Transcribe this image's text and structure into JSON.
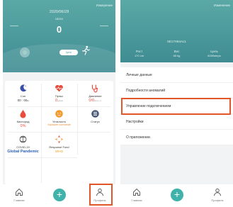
{
  "left": {
    "header": {
      "top_link": "Измерение",
      "date": "2020/06/28",
      "steps_label": "Шаги",
      "steps_value": "0",
      "goal_button": "Цель"
    },
    "tiles": [
      {
        "label": "Сон",
        "value": "00 : 00",
        "value_unit": "м",
        "icon": "moon-icon",
        "value_style": "plain"
      },
      {
        "label": "Пульс",
        "value": "0",
        "value_unit": "уд/мин",
        "icon": "heart-pulse-icon",
        "value_style": "red"
      },
      {
        "label": "Давление",
        "value": "0/0",
        "value_unit": "мм рт. ст.",
        "icon": "stethoscope-icon",
        "value_style": "red"
      },
      {
        "label": "Кислород",
        "value": "0%",
        "value_unit": "",
        "icon": "oxygen-drop-icon",
        "value_style": "red"
      },
      {
        "label": "Усталость",
        "value": "Хорошее состояние",
        "value_unit": "",
        "icon": "fatigue-face-icon",
        "value_style": "orange"
      },
      {
        "label": "Статус",
        "value": "",
        "value_unit": "",
        "icon": "status-icon",
        "value_style": "plain"
      },
      {
        "label": "COVID-19",
        "value": "Global Pandemic",
        "value_unit": "",
        "icon": "covid-icon",
        "value_style": "blue"
      },
      {
        "label": "Response Fund",
        "value": "WHO",
        "value_unit": "",
        "icon": "response-fund-icon",
        "value_style": "gold"
      }
    ],
    "nav": {
      "home": "Главная",
      "profile": "Профиль"
    }
  },
  "right": {
    "header": {
      "top_link": "Изменение",
      "profile_id": "5E17H84Ac1",
      "stats": [
        {
          "label": "Рост",
          "value": "170 cm"
        },
        {
          "label": "Вес",
          "value": "65 kg"
        },
        {
          "label": "Цель",
          "value": "8000steps"
        }
      ]
    },
    "menu": [
      "Личные данные",
      "Подробности аномалий",
      "Управление подключением",
      "Настройки",
      "О приложении"
    ],
    "nav": {
      "home": "Главная",
      "profile": "Профиль"
    }
  },
  "colors": {
    "header_teal": "#4d9e9d",
    "accent_teal": "#3fb2ab",
    "highlight_orange": "#e2572a",
    "red_value": "#e94b3c"
  }
}
